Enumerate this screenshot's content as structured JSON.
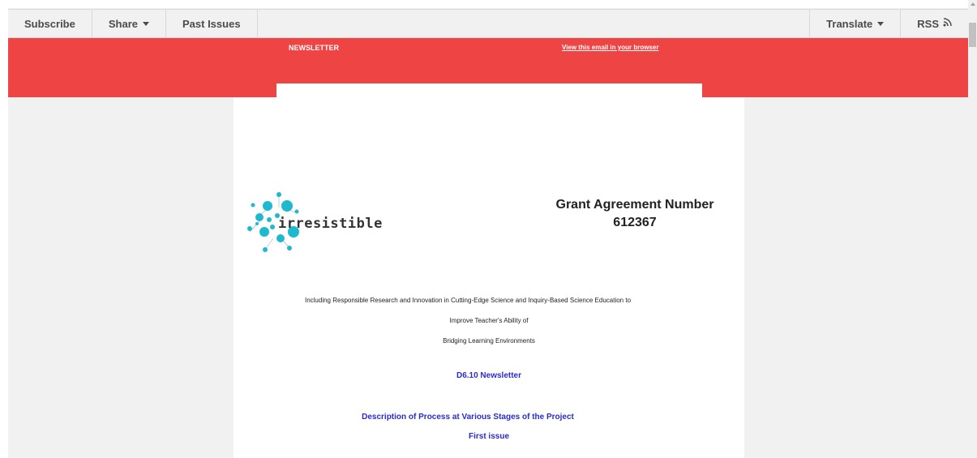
{
  "nav": {
    "subscribe": "Subscribe",
    "share": "Share",
    "past_issues": "Past Issues",
    "translate": "Translate",
    "rss": "RSS",
    "rss_icon": "rss-icon",
    "caret_icon": "caret-down-icon"
  },
  "banner": {
    "label": "NEWSLETTER",
    "view_link": "View this email in your browser",
    "color": "#ef4444"
  },
  "content": {
    "logo_text": "irresistible",
    "grant_title": "Grant Agreement Number",
    "grant_number": "612367",
    "line1": "Including Responsible Research and Innovation in Cutting-Edge Science and Inquiry-Based Science Education to",
    "line2": "Improve Teacher's Ability of",
    "line3": "Bridging Learning Environments",
    "newsletter_id": "D6.10 Newsletter",
    "description": "Description of Process at Various Stages of the Project",
    "issue": "First issue",
    "accent_color": "#2a2ad4"
  }
}
